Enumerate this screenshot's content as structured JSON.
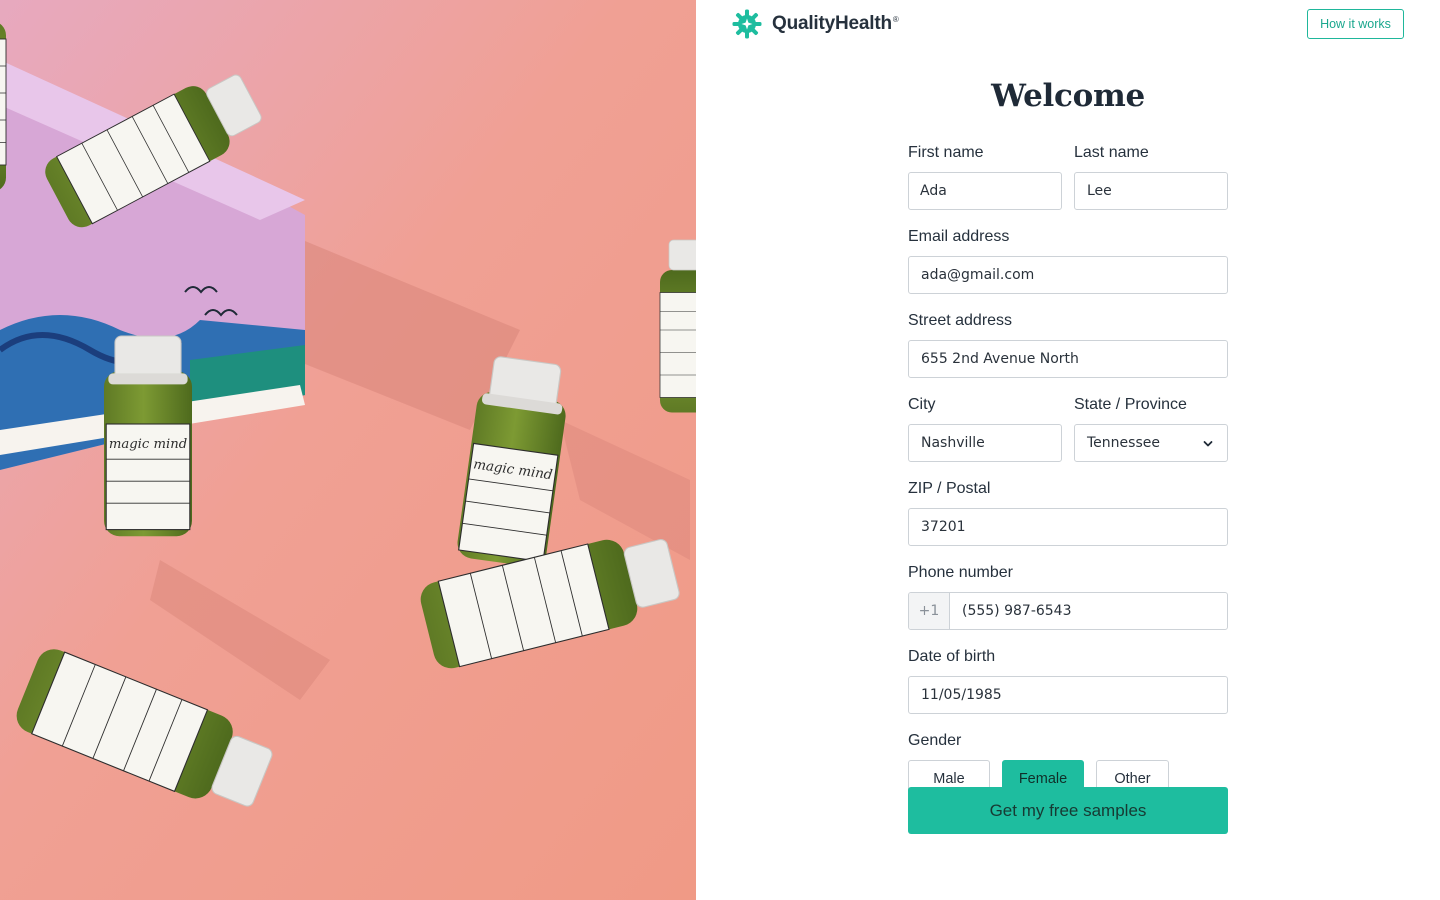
{
  "brand": {
    "name": "QualityHealth",
    "trademark": "®",
    "accent": "#1ebd9f"
  },
  "header": {
    "how_it_works": "How it works"
  },
  "form": {
    "title": "Welcome",
    "first_name": {
      "label": "First name",
      "value": "Ada"
    },
    "last_name": {
      "label": "Last name",
      "value": "Lee"
    },
    "email": {
      "label": "Email address",
      "value": "ada@gmail.com"
    },
    "street": {
      "label": "Street address",
      "value": "655 2nd Avenue North"
    },
    "city": {
      "label": "City",
      "value": "Nashville"
    },
    "state": {
      "label": "State / Province",
      "value": "Tennessee",
      "icon": "chevron-down-icon"
    },
    "zip": {
      "label": "ZIP / Postal",
      "value": "37201"
    },
    "phone": {
      "label": "Phone number",
      "prefix": "+1",
      "value": "(555) 987-6543"
    },
    "dob": {
      "label": "Date of birth",
      "value": "11/05/1985"
    },
    "gender": {
      "label": "Gender",
      "options": [
        "Male",
        "Female",
        "Other"
      ],
      "selected": "Female"
    },
    "submit": "Get my free samples"
  },
  "hero": {
    "image": "photo of green magic mind shot bottles on a pink background"
  }
}
